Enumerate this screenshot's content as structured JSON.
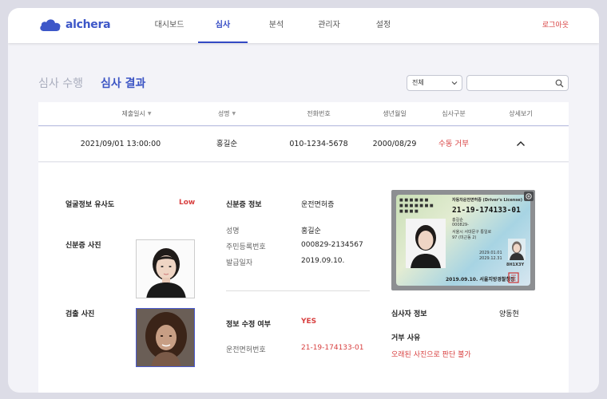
{
  "brand": {
    "name": "alchera",
    "color": "#3d57c8"
  },
  "nav": {
    "items": [
      {
        "label": "대시보드",
        "active": false
      },
      {
        "label": "심사",
        "active": true
      },
      {
        "label": "분석",
        "active": false
      },
      {
        "label": "관리자",
        "active": false
      },
      {
        "label": "설정",
        "active": false
      }
    ],
    "logout_label": "로그아웃"
  },
  "tabs": {
    "perform_label": "심사 수행",
    "result_label": "심사 결과"
  },
  "filter": {
    "selected": "전체",
    "search_placeholder": ""
  },
  "table": {
    "headers": [
      "제출일시",
      "성명",
      "전화번호",
      "생년월일",
      "심사구분",
      "상세보기"
    ],
    "row": {
      "submitted_at": "2021/09/01 13:00:00",
      "name": "홍길순",
      "phone": "010-1234-5678",
      "birth_date": "2000/08/29",
      "review_type": "수동 거부"
    }
  },
  "detail": {
    "face_similarity_label": "얼굴정보 유사도",
    "face_similarity_value": "Low",
    "id_photo_label": "신분증 사진",
    "detected_photo_label": "검출 사진",
    "id_info_label": "신분증 정보",
    "id_type": "운전면허증",
    "name_label": "성명",
    "name_value": "홍길순",
    "rrn_label": "주민등록번호",
    "rrn_value": "000829-2134567",
    "issue_label": "발급일자",
    "issue_value": "2019.09.10.",
    "modified_label": "정보 수정 여부",
    "modified_value": "YES",
    "license_no_label": "운전면허번호",
    "license_no_value": "21-19-174133-01",
    "reviewer_label": "심사자 정보",
    "reviewer_value": "양동현",
    "reject_reason_label": "거부 사유",
    "reject_reason_value": "오래된 사진으로 판단 불가"
  },
  "id_card": {
    "title": "자동차운전면허증 (Driver's License)",
    "number": "21-19-174133-01",
    "holder": "홍길순",
    "rrn": "000829-",
    "address": "서울시 서대문구 통일로",
    "address2": "97 (미근동 2)",
    "issued": "2029.01.01",
    "valid": "2029.12.31",
    "code": "8H1X3Y",
    "footer": "2019.09.10. 서울지방경찰청장"
  },
  "colors": {
    "accent": "#3349c4",
    "danger": "#d84040"
  }
}
